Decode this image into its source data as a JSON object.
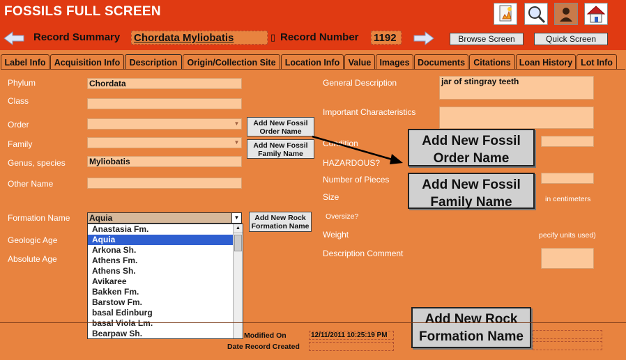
{
  "app": {
    "title": "FOSSILS FULL SCREEN"
  },
  "toolbar_icons": [
    "new-record-icon",
    "magnifier-icon",
    "user-icon",
    "home-icon"
  ],
  "nav": {
    "record_summary_label": "Record Summary",
    "record_summary_value": "Chordata Myliobatis",
    "record_number_label": "Record Number",
    "record_number_value": "1192",
    "browse_button": "Browse Screen",
    "quick_button": "Quick Screen"
  },
  "tabs": [
    "Label Info",
    "Acquisition Info",
    "Description",
    "Origin/Collection Site",
    "Location Info",
    "Value",
    "Images",
    "Documents",
    "Citations",
    "Loan History",
    "Lot Info"
  ],
  "active_tab": "Description",
  "left_form": {
    "phylum_label": "Phylum",
    "phylum_value": "Chordata",
    "class_label": "Class",
    "class_value": "",
    "order_label": "Order",
    "order_value": "",
    "family_label": "Family",
    "family_value": "",
    "genus_label": "Genus, species",
    "genus_value": "Myliobatis",
    "other_label": "Other Name",
    "other_value": "",
    "formation_label": "Formation Name",
    "formation_value": "Aquia",
    "geologic_label": "Geologic Age",
    "absolute_label": "Absolute Age"
  },
  "small_buttons": {
    "order": "Add New Fossil Order Name",
    "family": "Add New Fossil Family Name",
    "rock": "Add New Rock Formation Name"
  },
  "formation_options": [
    "Anastasia Fm.",
    "Aquia",
    "Arkona Sh.",
    "Athens Fm.",
    "Athens Sh.",
    "Avikaree",
    "Bakken Fm.",
    "Barstow Fm.",
    "basal Edinburg",
    "basal Viola Lm.",
    "Bearpaw Sh."
  ],
  "right_form": {
    "general_label": "General Description",
    "general_value": "jar of stingray teeth",
    "important_label": "Important Characteristics",
    "condition_label": "Condition",
    "hazardous_label": "HAZARDOUS?",
    "pieces_label": "Number of Pieces",
    "size_label": "Size",
    "size_units": "in centimeters",
    "oversize_label": "Oversize?",
    "weight_label": "Weight",
    "weight_units": "pecify units used)",
    "comment_label": "Description Comment"
  },
  "callouts": {
    "order": "Add New Fossil Order Name",
    "family": "Add New Fossil Family Name",
    "rock": "Add New Rock Formation Name"
  },
  "footer": {
    "modified_label": "Modified On",
    "modified_value": "12/11/2011 10:25:19 PM",
    "created_label": "Date Record Created"
  },
  "colors": {
    "header_bg": "#e03a12",
    "body_bg": "#e8833f",
    "field_bg": "#fcc89a",
    "selected": "#2f5fd0"
  }
}
